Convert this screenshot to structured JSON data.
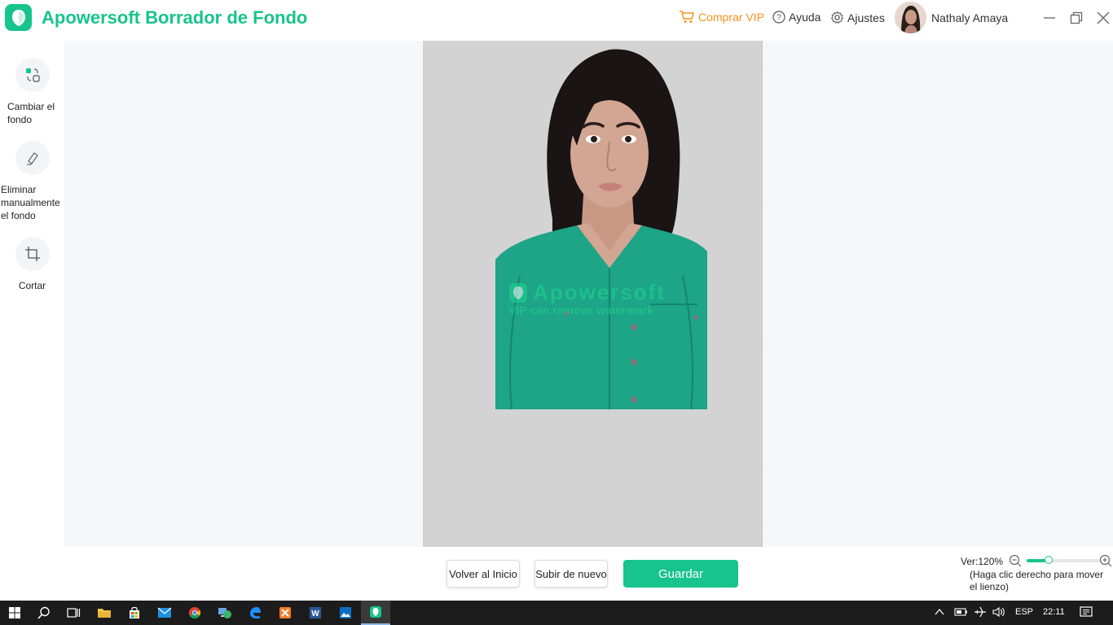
{
  "app": {
    "title": "Apowersoft Borrador de Fondo",
    "accent_color": "#17c48b",
    "vip_color": "#f2921f"
  },
  "header": {
    "buy_vip": "Comprar VIP",
    "help": "Ayuda",
    "settings": "Ajustes",
    "user_name": "Nathaly Amaya"
  },
  "sidebar": {
    "items": [
      {
        "label": "Cambiar el fondo",
        "icon": "change-background-icon"
      },
      {
        "label": "Eliminar manualmente el fondo",
        "icon": "manual-erase-icon"
      },
      {
        "label": "Cortar",
        "icon": "crop-icon"
      }
    ]
  },
  "canvas": {
    "watermark_title": "Apowersoft",
    "watermark_sub": "VIP can remove watermark"
  },
  "footer": {
    "back_home": "Volver al Inicio",
    "upload_again": "Subir de nuevo",
    "save": "Guardar",
    "zoom_label": "Ver:120%",
    "zoom_level": 0.3,
    "hint": "(Haga clic derecho para mover el lienzo)"
  },
  "taskbar": {
    "apps": [
      "start-icon",
      "search-icon",
      "task-view-icon",
      "file-explorer-icon",
      "store-icon",
      "mail-icon",
      "chrome-icon",
      "network-app-icon",
      "edge-icon",
      "xampp-icon",
      "word-icon",
      "photos-icon",
      "apowersoft-icon"
    ],
    "language": "ESP",
    "time": "22:11"
  }
}
